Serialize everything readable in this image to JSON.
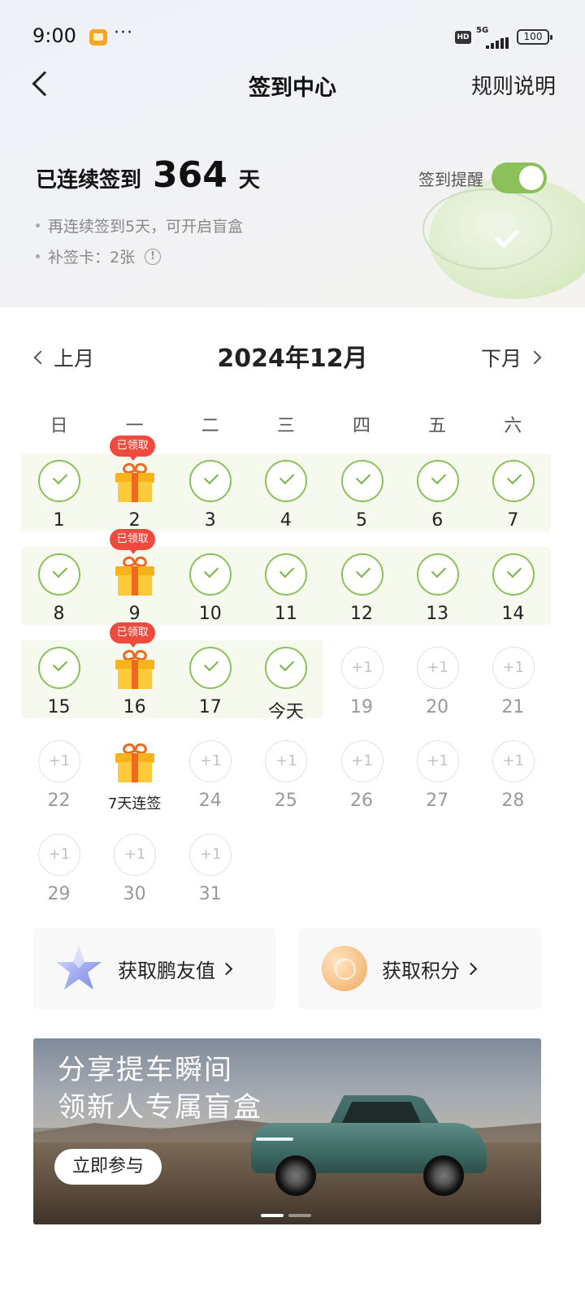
{
  "status_bar": {
    "time": "9:00",
    "dots": "···",
    "network": "5G",
    "hd": "HD",
    "battery": "100"
  },
  "nav": {
    "title": "签到中心",
    "rules": "规则说明"
  },
  "streak": {
    "prefix": "已连续签到",
    "days": "364",
    "suffix": "天",
    "reminder_label": "签到提醒",
    "reminder_on": true,
    "hint_blindbox": "再连续签到5天，可开启盲盒",
    "hint_makeup_card": "补签卡：2张",
    "info_icon": "!"
  },
  "calendar": {
    "prev_label": "上月",
    "next_label": "下月",
    "month_title": "2024年12月",
    "weekdays": [
      "日",
      "一",
      "二",
      "三",
      "四",
      "五",
      "六"
    ],
    "claimed_label": "已领取",
    "plus_label": "+1",
    "days": [
      {
        "label": "1",
        "state": "done"
      },
      {
        "label": "2",
        "state": "gift-claimed"
      },
      {
        "label": "3",
        "state": "done"
      },
      {
        "label": "4",
        "state": "done"
      },
      {
        "label": "5",
        "state": "done"
      },
      {
        "label": "6",
        "state": "done"
      },
      {
        "label": "7",
        "state": "done"
      },
      {
        "label": "8",
        "state": "done"
      },
      {
        "label": "9",
        "state": "gift-claimed"
      },
      {
        "label": "10",
        "state": "done"
      },
      {
        "label": "11",
        "state": "done"
      },
      {
        "label": "12",
        "state": "done"
      },
      {
        "label": "13",
        "state": "done"
      },
      {
        "label": "14",
        "state": "done"
      },
      {
        "label": "15",
        "state": "done"
      },
      {
        "label": "16",
        "state": "gift-claimed"
      },
      {
        "label": "17",
        "state": "done"
      },
      {
        "label": "今天",
        "state": "done"
      },
      {
        "label": "19",
        "state": "future"
      },
      {
        "label": "20",
        "state": "future"
      },
      {
        "label": "21",
        "state": "future"
      },
      {
        "label": "22",
        "state": "future"
      },
      {
        "label": "7天连签",
        "state": "gift"
      },
      {
        "label": "24",
        "state": "future"
      },
      {
        "label": "25",
        "state": "future"
      },
      {
        "label": "26",
        "state": "future"
      },
      {
        "label": "27",
        "state": "future"
      },
      {
        "label": "28",
        "state": "future"
      },
      {
        "label": "29",
        "state": "future"
      },
      {
        "label": "30",
        "state": "future"
      },
      {
        "label": "31",
        "state": "future"
      }
    ]
  },
  "rewards": {
    "friend_value": "获取鹏友值",
    "points": "获取积分"
  },
  "banner": {
    "line1": "分享提车瞬间",
    "line2": "领新人专属盲盒",
    "button": "立即参与",
    "slide_count": 2,
    "active_slide": 1
  },
  "colors": {
    "accent_green": "#8cc05a",
    "badge_red": "#f04a3e",
    "gift_orange": "#f8b21c"
  }
}
